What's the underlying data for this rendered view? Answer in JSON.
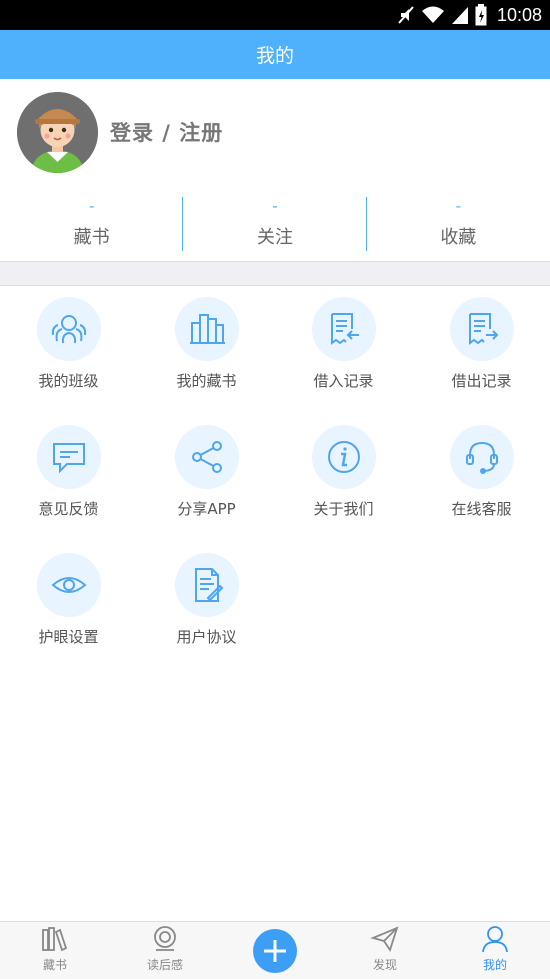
{
  "status_bar": {
    "time": "10:08"
  },
  "header": {
    "title": "我的"
  },
  "profile": {
    "login_text": "登录 / 注册"
  },
  "stats": [
    {
      "value": "-",
      "label": "藏书"
    },
    {
      "value": "-",
      "label": "关注"
    },
    {
      "value": "-",
      "label": "收藏"
    }
  ],
  "grid": [
    {
      "label": "我的班级",
      "icon": "class-icon"
    },
    {
      "label": "我的藏书",
      "icon": "books-icon"
    },
    {
      "label": "借入记录",
      "icon": "borrow-in-icon"
    },
    {
      "label": "借出记录",
      "icon": "borrow-out-icon"
    },
    {
      "label": "意见反馈",
      "icon": "feedback-icon"
    },
    {
      "label": "分享APP",
      "icon": "share-icon"
    },
    {
      "label": "关于我们",
      "icon": "info-icon"
    },
    {
      "label": "在线客服",
      "icon": "headset-icon"
    },
    {
      "label": "护眼设置",
      "icon": "eye-icon"
    },
    {
      "label": "用户协议",
      "icon": "document-icon"
    }
  ],
  "bottom_nav": [
    {
      "label": "藏书",
      "icon": "bookshelf-icon"
    },
    {
      "label": "读后感",
      "icon": "review-icon"
    },
    {
      "label": "",
      "icon": "plus-icon"
    },
    {
      "label": "发现",
      "icon": "paper-plane-icon"
    },
    {
      "label": "我的",
      "icon": "person-icon"
    }
  ],
  "colors": {
    "primary": "#4fb0fc",
    "icon_bg": "#e8f4ff",
    "active": "#2f95f5"
  }
}
